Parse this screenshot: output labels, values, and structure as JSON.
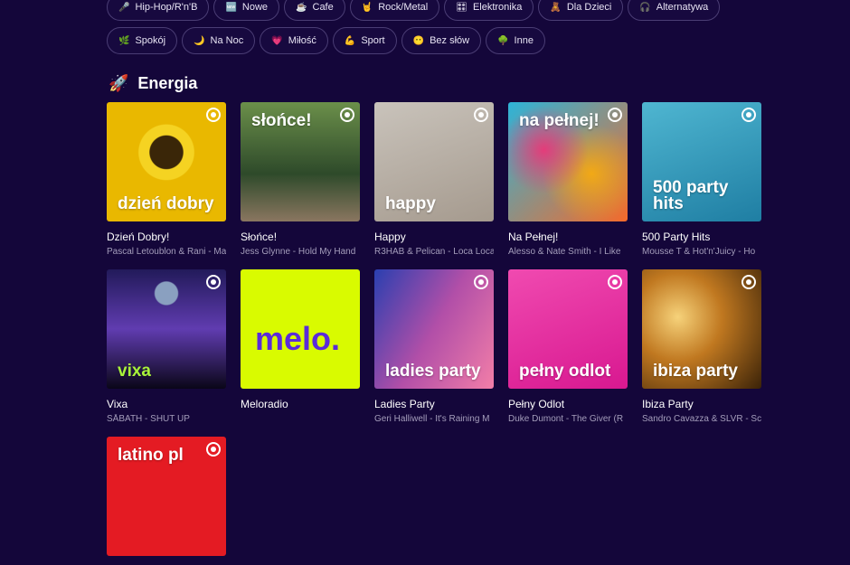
{
  "chips_row1": [
    {
      "icon": "🎤",
      "label": "Hip-Hop/R'n'B"
    },
    {
      "icon": "🆕",
      "label": "Nowe"
    },
    {
      "icon": "☕",
      "label": "Cafe"
    },
    {
      "icon": "🤘",
      "label": "Rock/Metal"
    },
    {
      "icon": "🎛",
      "label": "Elektronika"
    },
    {
      "icon": "🧸",
      "label": "Dla Dzieci"
    },
    {
      "icon": "🎧",
      "label": "Alternatywa"
    }
  ],
  "chips_row2": [
    {
      "icon": "🌿",
      "label": "Spokój"
    },
    {
      "icon": "🌙",
      "label": "Na Noc"
    },
    {
      "icon": "💗",
      "label": "Miłość"
    },
    {
      "icon": "💪",
      "label": "Sport"
    },
    {
      "icon": "😶",
      "label": "Bez słów"
    },
    {
      "icon": "🌳",
      "label": "Inne"
    }
  ],
  "section": {
    "icon": "🚀",
    "title": "Energia"
  },
  "cards": [
    {
      "art": "dzień dobry",
      "title": "Dzień Dobry!",
      "sub": "Pascal Letoublon & Rani - Ma"
    },
    {
      "art": "słońce!",
      "title": "Słońce!",
      "sub": "Jess Glynne - Hold My Hand"
    },
    {
      "art": "happy",
      "title": "Happy",
      "sub": "R3HAB & Pelican - Loca Loca"
    },
    {
      "art": "na pełnej!",
      "title": "Na Pełnej!",
      "sub": "Alesso & Nate Smith - I Like"
    },
    {
      "art": "500 party hits",
      "title": "500 Party Hits",
      "sub": "Mousse T & Hot'n'Juicy - Ho"
    },
    {
      "art": "vixa",
      "title": "Vixa",
      "sub": "SÅBATH - SHUT UP"
    },
    {
      "art": "melo.",
      "title": "Meloradio",
      "sub": ""
    },
    {
      "art": "ladies party",
      "title": "Ladies Party",
      "sub": "Geri Halliwell - It's Raining M"
    },
    {
      "art": "pełny odlot",
      "title": "Pełny Odlot",
      "sub": "Duke Dumont - The Giver (R"
    },
    {
      "art": "ibiza party",
      "title": "Ibiza Party",
      "sub": "Sandro Cavazza & SLVR - Sc"
    },
    {
      "art": "latino pl",
      "title": "",
      "sub": ""
    }
  ]
}
